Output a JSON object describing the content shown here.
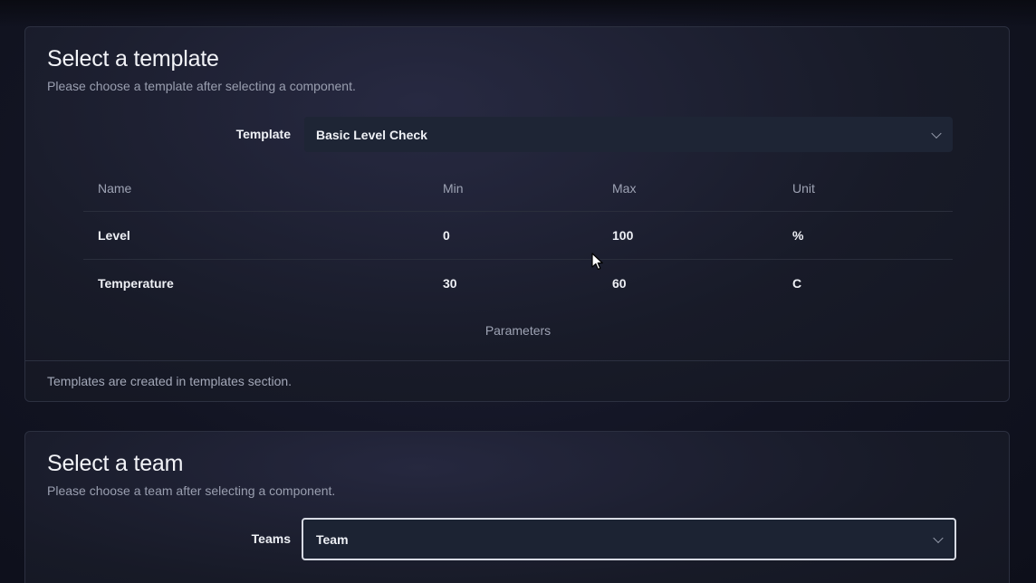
{
  "template_section": {
    "title": "Select a template",
    "subtitle": "Please choose a template after selecting a component.",
    "field_label": "Template",
    "selected_value": "Basic Level Check",
    "table": {
      "columns": [
        "Name",
        "Min",
        "Max",
        "Unit"
      ],
      "rows": [
        {
          "name": "Level",
          "min": "0",
          "max": "100",
          "unit": "%"
        },
        {
          "name": "Temperature",
          "min": "30",
          "max": "60",
          "unit": "C"
        }
      ],
      "caption": "Parameters"
    },
    "footer": "Templates are created in templates section."
  },
  "team_section": {
    "title": "Select a team",
    "subtitle": "Please choose a team after selecting a component.",
    "field_label": "Teams",
    "selected_value": "Team"
  },
  "icons": {
    "select_chevron": "chevron-down-icon",
    "cursor": "mouse-pointer-icon"
  },
  "colors": {
    "background": "#121422",
    "card_border": "#2c3040",
    "select_background": "#1e2535",
    "focus_border": "#d7dae3",
    "text_primary": "#eef0f5",
    "text_muted": "#9ea3b4"
  }
}
